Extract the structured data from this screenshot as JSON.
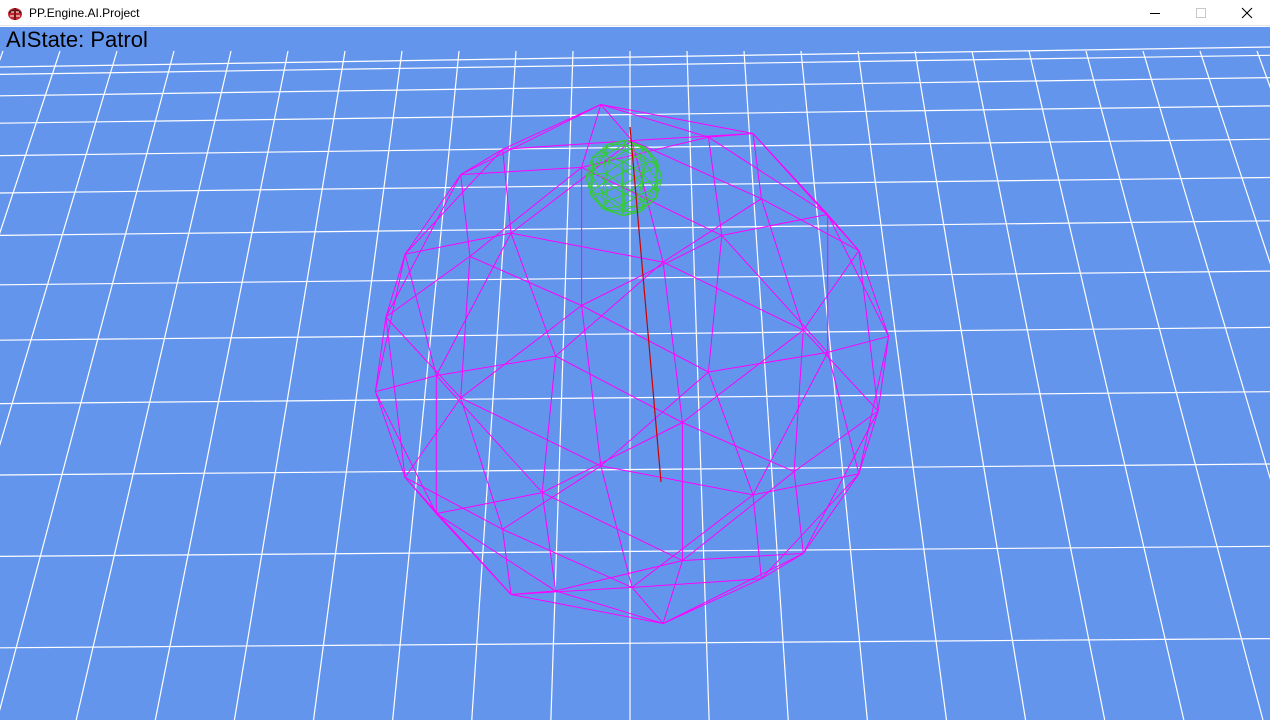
{
  "window": {
    "title": "PP.Engine.AI.Project",
    "controls": {
      "minimize_icon": "minimize-icon",
      "maximize_icon": "maximize-icon",
      "close_icon": "close-icon"
    }
  },
  "hud": {
    "ai_state": "AIState: Patrol"
  },
  "scene": {
    "background_color": "#6495ed",
    "grid_color": "#ffffff",
    "detection_sphere_color": "#ff00ff",
    "agent_sphere_color": "#33cc33",
    "direction_line_color": "#cc0000"
  }
}
